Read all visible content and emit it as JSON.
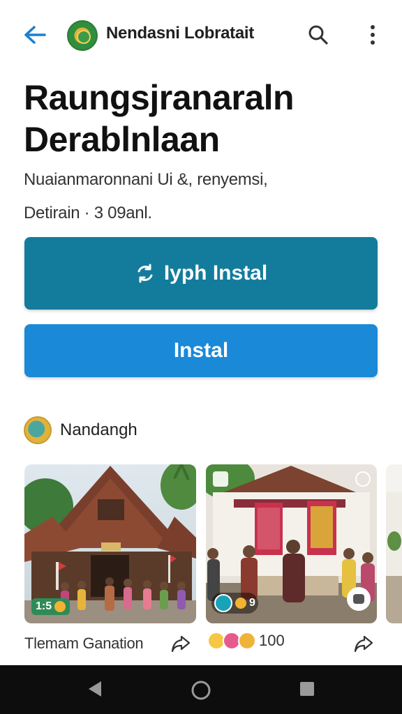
{
  "header": {
    "app_name": "Nendasni Lobratait",
    "icons": {
      "back": "arrow-left-icon",
      "search": "search-icon",
      "more": "more-vertical-icon"
    }
  },
  "app": {
    "title": "Raungsjranaraln Derablnlaan",
    "subtitle": "Nuaianmaronnani Ui  &, renyemsi,",
    "meta": "Detirain · 3 09anl."
  },
  "buttons": {
    "primary_label": "Iyph Instal",
    "secondary_label": "Instal"
  },
  "developer": {
    "name": "Nandangh"
  },
  "gallery": {
    "card1": {
      "caption": "Tlemam Ganation",
      "badge": "1:5"
    },
    "card2": {
      "reaction_count": "100",
      "badge": "9"
    }
  },
  "colors": {
    "primary_button": "#137c9c",
    "secondary_button": "#1a89d8",
    "accent_back": "#1a7fd0",
    "navbar": "#0d0d0d"
  }
}
